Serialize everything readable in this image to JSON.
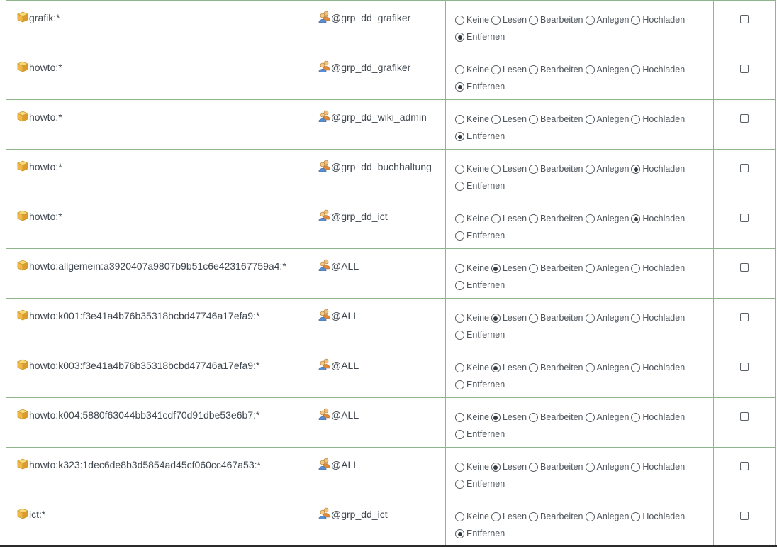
{
  "permission_labels": [
    "Keine",
    "Lesen",
    "Bearbeiten",
    "Anlegen",
    "Hochladen",
    "Entfernen"
  ],
  "icons": {
    "namespace": "namespace-icon",
    "group": "group-icon"
  },
  "colors": {
    "border": "#8fb58a",
    "text": "#4a4f56",
    "icon_yellow": "#f3c246"
  },
  "rows": [
    {
      "page": "grafik:*",
      "user": "@grp_dd_grafiker",
      "selected": "Entfernen"
    },
    {
      "page": "howto:*",
      "user": "@grp_dd_grafiker",
      "selected": "Entfernen"
    },
    {
      "page": "howto:*",
      "user": "@grp_dd_wiki_admin",
      "selected": "Entfernen"
    },
    {
      "page": "howto:*",
      "user": "@grp_dd_buchhaltung",
      "selected": "Hochladen"
    },
    {
      "page": "howto:*",
      "user": "@grp_dd_ict",
      "selected": "Hochladen"
    },
    {
      "page": "howto:allgemein:a3920407a9807b9b51c6e423167759a4:*",
      "user": "@ALL",
      "selected": "Lesen"
    },
    {
      "page": "howto:k001:f3e41a4b76b35318bcbd47746a17efa9:*",
      "user": "@ALL",
      "selected": "Lesen"
    },
    {
      "page": "howto:k003:f3e41a4b76b35318bcbd47746a17efa9:*",
      "user": "@ALL",
      "selected": "Lesen"
    },
    {
      "page": "howto:k004:5880f63044bb341cdf70d91dbe53e6b7:*",
      "user": "@ALL",
      "selected": "Lesen"
    },
    {
      "page": "howto:k323:1dec6de8b3d5854ad45cf060cc467a53:*",
      "user": "@ALL",
      "selected": "Lesen"
    },
    {
      "page": "ict:*",
      "user": "@grp_dd_ict",
      "selected": "Entfernen"
    }
  ]
}
